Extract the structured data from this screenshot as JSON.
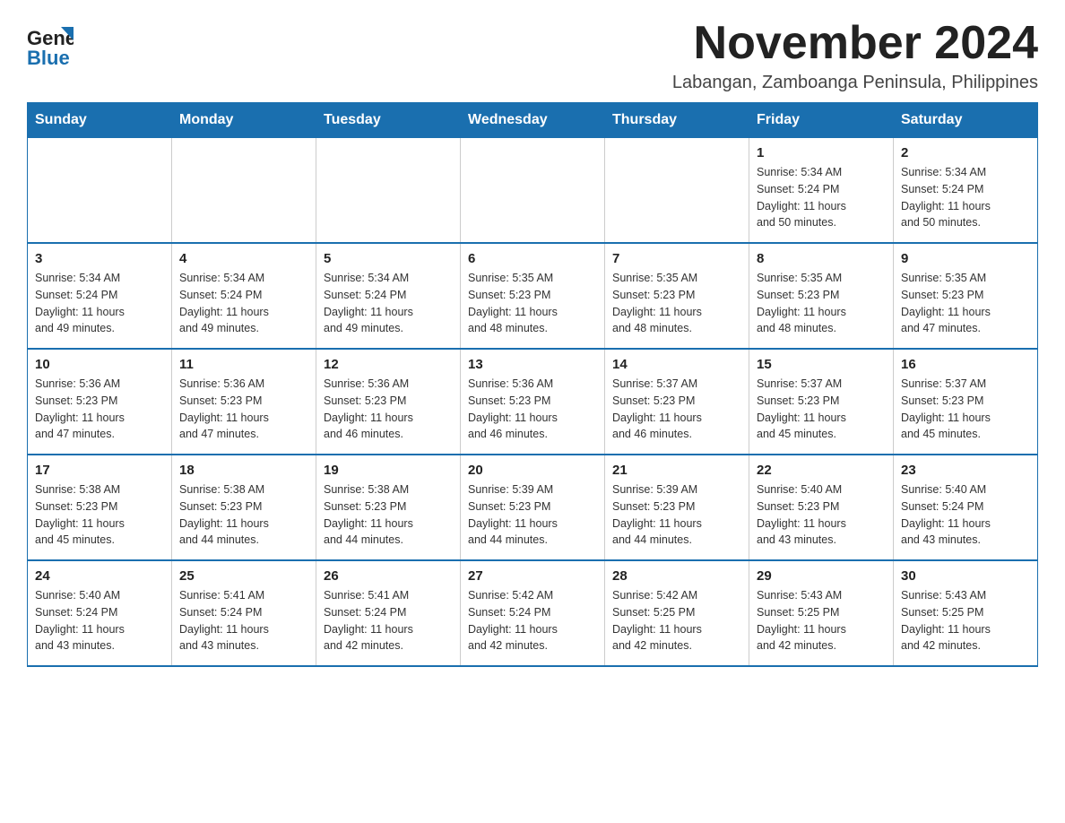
{
  "logo": {
    "general": "General",
    "blue": "Blue"
  },
  "header": {
    "month_title": "November 2024",
    "subtitle": "Labangan, Zamboanga Peninsula, Philippines"
  },
  "calendar": {
    "days_of_week": [
      "Sunday",
      "Monday",
      "Tuesday",
      "Wednesday",
      "Thursday",
      "Friday",
      "Saturday"
    ],
    "weeks": [
      [
        {
          "day": "",
          "info": ""
        },
        {
          "day": "",
          "info": ""
        },
        {
          "day": "",
          "info": ""
        },
        {
          "day": "",
          "info": ""
        },
        {
          "day": "",
          "info": ""
        },
        {
          "day": "1",
          "info": "Sunrise: 5:34 AM\nSunset: 5:24 PM\nDaylight: 11 hours\nand 50 minutes."
        },
        {
          "day": "2",
          "info": "Sunrise: 5:34 AM\nSunset: 5:24 PM\nDaylight: 11 hours\nand 50 minutes."
        }
      ],
      [
        {
          "day": "3",
          "info": "Sunrise: 5:34 AM\nSunset: 5:24 PM\nDaylight: 11 hours\nand 49 minutes."
        },
        {
          "day": "4",
          "info": "Sunrise: 5:34 AM\nSunset: 5:24 PM\nDaylight: 11 hours\nand 49 minutes."
        },
        {
          "day": "5",
          "info": "Sunrise: 5:34 AM\nSunset: 5:24 PM\nDaylight: 11 hours\nand 49 minutes."
        },
        {
          "day": "6",
          "info": "Sunrise: 5:35 AM\nSunset: 5:23 PM\nDaylight: 11 hours\nand 48 minutes."
        },
        {
          "day": "7",
          "info": "Sunrise: 5:35 AM\nSunset: 5:23 PM\nDaylight: 11 hours\nand 48 minutes."
        },
        {
          "day": "8",
          "info": "Sunrise: 5:35 AM\nSunset: 5:23 PM\nDaylight: 11 hours\nand 48 minutes."
        },
        {
          "day": "9",
          "info": "Sunrise: 5:35 AM\nSunset: 5:23 PM\nDaylight: 11 hours\nand 47 minutes."
        }
      ],
      [
        {
          "day": "10",
          "info": "Sunrise: 5:36 AM\nSunset: 5:23 PM\nDaylight: 11 hours\nand 47 minutes."
        },
        {
          "day": "11",
          "info": "Sunrise: 5:36 AM\nSunset: 5:23 PM\nDaylight: 11 hours\nand 47 minutes."
        },
        {
          "day": "12",
          "info": "Sunrise: 5:36 AM\nSunset: 5:23 PM\nDaylight: 11 hours\nand 46 minutes."
        },
        {
          "day": "13",
          "info": "Sunrise: 5:36 AM\nSunset: 5:23 PM\nDaylight: 11 hours\nand 46 minutes."
        },
        {
          "day": "14",
          "info": "Sunrise: 5:37 AM\nSunset: 5:23 PM\nDaylight: 11 hours\nand 46 minutes."
        },
        {
          "day": "15",
          "info": "Sunrise: 5:37 AM\nSunset: 5:23 PM\nDaylight: 11 hours\nand 45 minutes."
        },
        {
          "day": "16",
          "info": "Sunrise: 5:37 AM\nSunset: 5:23 PM\nDaylight: 11 hours\nand 45 minutes."
        }
      ],
      [
        {
          "day": "17",
          "info": "Sunrise: 5:38 AM\nSunset: 5:23 PM\nDaylight: 11 hours\nand 45 minutes."
        },
        {
          "day": "18",
          "info": "Sunrise: 5:38 AM\nSunset: 5:23 PM\nDaylight: 11 hours\nand 44 minutes."
        },
        {
          "day": "19",
          "info": "Sunrise: 5:38 AM\nSunset: 5:23 PM\nDaylight: 11 hours\nand 44 minutes."
        },
        {
          "day": "20",
          "info": "Sunrise: 5:39 AM\nSunset: 5:23 PM\nDaylight: 11 hours\nand 44 minutes."
        },
        {
          "day": "21",
          "info": "Sunrise: 5:39 AM\nSunset: 5:23 PM\nDaylight: 11 hours\nand 44 minutes."
        },
        {
          "day": "22",
          "info": "Sunrise: 5:40 AM\nSunset: 5:23 PM\nDaylight: 11 hours\nand 43 minutes."
        },
        {
          "day": "23",
          "info": "Sunrise: 5:40 AM\nSunset: 5:24 PM\nDaylight: 11 hours\nand 43 minutes."
        }
      ],
      [
        {
          "day": "24",
          "info": "Sunrise: 5:40 AM\nSunset: 5:24 PM\nDaylight: 11 hours\nand 43 minutes."
        },
        {
          "day": "25",
          "info": "Sunrise: 5:41 AM\nSunset: 5:24 PM\nDaylight: 11 hours\nand 43 minutes."
        },
        {
          "day": "26",
          "info": "Sunrise: 5:41 AM\nSunset: 5:24 PM\nDaylight: 11 hours\nand 42 minutes."
        },
        {
          "day": "27",
          "info": "Sunrise: 5:42 AM\nSunset: 5:24 PM\nDaylight: 11 hours\nand 42 minutes."
        },
        {
          "day": "28",
          "info": "Sunrise: 5:42 AM\nSunset: 5:25 PM\nDaylight: 11 hours\nand 42 minutes."
        },
        {
          "day": "29",
          "info": "Sunrise: 5:43 AM\nSunset: 5:25 PM\nDaylight: 11 hours\nand 42 minutes."
        },
        {
          "day": "30",
          "info": "Sunrise: 5:43 AM\nSunset: 5:25 PM\nDaylight: 11 hours\nand 42 minutes."
        }
      ]
    ]
  }
}
